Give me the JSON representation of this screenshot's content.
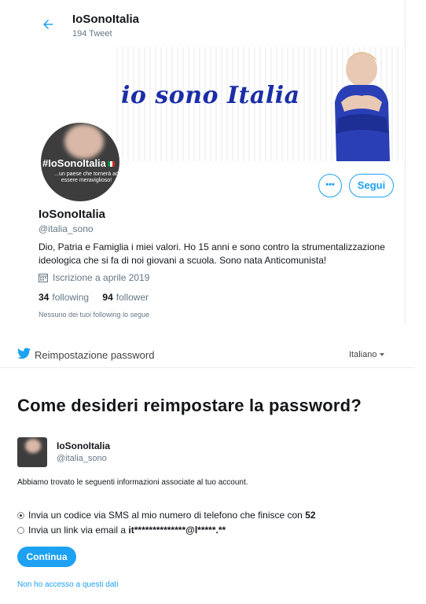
{
  "profile_header": {
    "name": "IoSonoItalia",
    "tweet_count": "194 Tweet"
  },
  "banner": {
    "text": "io sono Italia",
    "brand_color": "#1a2ea8"
  },
  "avatar": {
    "hashtag": "#IoSonoItalia",
    "subtitle": "...un paese che tornerà ad essere meraviglioso!"
  },
  "actions": {
    "more_label": "•••",
    "follow_label": "Segui"
  },
  "profile": {
    "name": "IoSonoItalia",
    "handle": "@italia_sono",
    "bio": "Dio, Patria e Famiglia i miei valori. Ho 15 anni e sono contro la strumentalizzazione ideologica che si fa di noi giovani a scuola. Sono nata Anticomunista!",
    "joined": "Iscrizione a aprile 2019",
    "following_count": "34",
    "following_label": "following",
    "follower_count": "94",
    "follower_label": "follower",
    "mutual_note": "Nessuno dei tuoi following lo segue"
  },
  "reset": {
    "header_title": "Reimpostazione password",
    "language": "Italiano",
    "heading": "Come desideri reimpostare la password?",
    "user_name": "IoSonoItalia",
    "user_handle": "@italia_sono",
    "info": "Abbiamo trovato le seguenti informazioni associate al tuo account.",
    "option_sms_prefix": "Invia un codice via SMS al mio numero di telefono che finisce con ",
    "option_sms_digits": "52",
    "option_sms_selected": true,
    "option_email_prefix": "Invia un link via email a ",
    "option_email_masked": "it**************@l*****.**",
    "continue_label": "Continua",
    "no_access_link": "Non ho accesso a questi dati"
  },
  "colors": {
    "accent": "#1da1f2",
    "text": "#14171a",
    "muted": "#657786"
  }
}
